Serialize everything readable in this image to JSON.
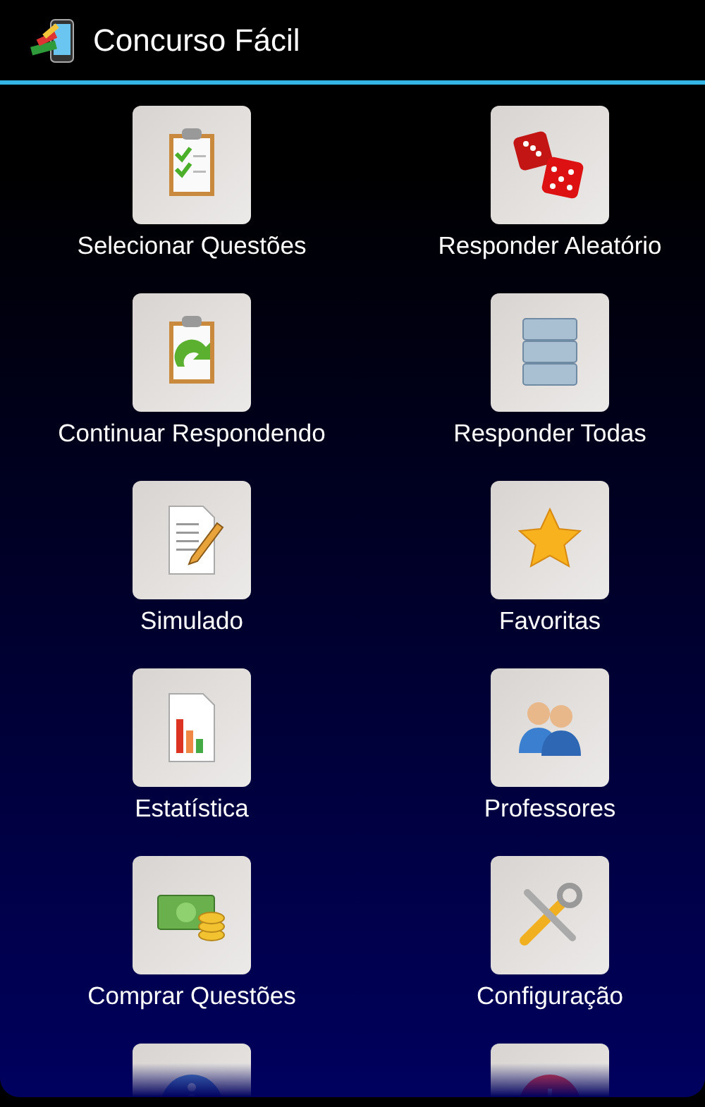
{
  "action_bar": {
    "title": "Concurso Fácil"
  },
  "menu": [
    {
      "kind": "labeled",
      "label": "Selecionar Questões"
    },
    {
      "kind": "labeled",
      "label": "Responder Aleatório"
    },
    {
      "kind": "labeled",
      "label": "Continuar Respondendo"
    },
    {
      "kind": "labeled",
      "label": "Responder Todas"
    },
    {
      "kind": "labeled",
      "label": "Simulado"
    },
    {
      "kind": "labeled",
      "label": "Favoritas"
    },
    {
      "kind": "labeled",
      "label": "Estatística"
    },
    {
      "kind": "labeled",
      "label": "Professores"
    },
    {
      "kind": "labeled",
      "label": "Comprar Questões"
    },
    {
      "kind": "labeled",
      "label": "Configuração"
    },
    {
      "kind": "cut_off"
    },
    {
      "kind": "cut_off"
    }
  ]
}
